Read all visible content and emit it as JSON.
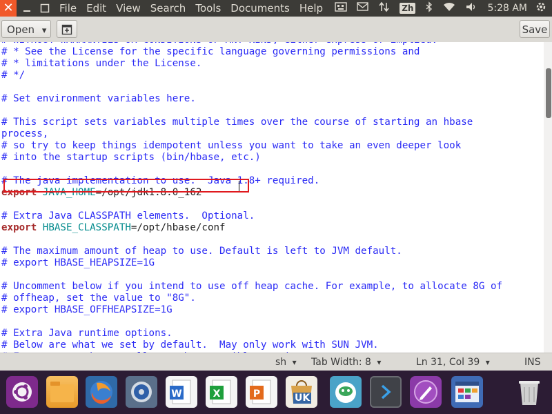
{
  "top_panel": {
    "close": "✕",
    "menu": [
      "File",
      "Edit",
      "View",
      "Search",
      "Tools",
      "Documents",
      "Help"
    ],
    "ime": "Zh",
    "clock": "5:28 AM"
  },
  "toolbar": {
    "open_label": "Open",
    "open_arrow": "▾",
    "new_tab_icon": "⊞",
    "save_label": "Save"
  },
  "editor": {
    "lines": [
      [
        {
          "t": "# WITHOUT WARRANTIES OR CONDITIONS OF ANY KIND, either express or implied.",
          "c": "comment"
        }
      ],
      [
        {
          "t": "# * See the License for the specific language governing permissions and",
          "c": "comment"
        }
      ],
      [
        {
          "t": "# * limitations under the License.",
          "c": "comment"
        }
      ],
      [
        {
          "t": "# */",
          "c": "comment"
        }
      ],
      [
        {
          "t": "",
          "c": "comment"
        }
      ],
      [
        {
          "t": "# Set environment variables here.",
          "c": "comment"
        }
      ],
      [
        {
          "t": "",
          "c": "comment"
        }
      ],
      [
        {
          "t": "# This script sets variables multiple times over the course of starting an hbase",
          "c": "comment"
        }
      ],
      [
        {
          "t": "process,",
          "c": "comment"
        }
      ],
      [
        {
          "t": "# so try to keep things idempotent unless you want to take an even deeper look",
          "c": "comment"
        }
      ],
      [
        {
          "t": "# into the startup scripts (bin/hbase, etc.)",
          "c": "comment"
        }
      ],
      [
        {
          "t": "",
          "c": "comment"
        }
      ],
      [
        {
          "t": "# The java implementation to use.  Java 1.8+ required.",
          "c": "comment"
        }
      ],
      [
        {
          "t": "export",
          "c": "kw"
        },
        {
          "t": " JAVA_HOME",
          "c": "var"
        },
        {
          "t": "=/opt/jdk1.8.0_162",
          "c": "plain"
        }
      ],
      [
        {
          "t": "",
          "c": "comment"
        }
      ],
      [
        {
          "t": "# Extra Java CLASSPATH elements.  Optional.",
          "c": "comment"
        }
      ],
      [
        {
          "t": "export",
          "c": "kw"
        },
        {
          "t": " HBASE_CLASSPATH",
          "c": "var"
        },
        {
          "t": "=/opt/hbase/conf",
          "c": "plain"
        }
      ],
      [
        {
          "t": "",
          "c": "comment"
        }
      ],
      [
        {
          "t": "# The maximum amount of heap to use. Default is left to JVM default.",
          "c": "comment"
        }
      ],
      [
        {
          "t": "# export HBASE_HEAPSIZE=1G",
          "c": "comment"
        }
      ],
      [
        {
          "t": "",
          "c": "comment"
        }
      ],
      [
        {
          "t": "# Uncomment below if you intend to use off heap cache. For example, to allocate 8G of",
          "c": "comment"
        }
      ],
      [
        {
          "t": "# offheap, set the value to \"8G\".",
          "c": "comment"
        }
      ],
      [
        {
          "t": "# export HBASE_OFFHEAPSIZE=1G",
          "c": "comment"
        }
      ],
      [
        {
          "t": "",
          "c": "comment"
        }
      ],
      [
        {
          "t": "# Extra Java runtime options.",
          "c": "comment"
        }
      ],
      [
        {
          "t": "# Below are what we set by default.  May only work with SUN JVM.",
          "c": "comment"
        }
      ],
      [
        {
          "t": "# For more on why as well as other possible settings,",
          "c": "comment"
        }
      ]
    ]
  },
  "status_bar": {
    "language": "sh",
    "tab_width": "Tab Width: 8",
    "position": "Ln 31, Col 39",
    "mode": "INS",
    "arrow": "▾"
  },
  "launcher": {
    "apps": [
      {
        "name": "ubuntu-dash-icon",
        "color": "#7e2a8c"
      },
      {
        "name": "files-icon",
        "color": "#f0a030"
      },
      {
        "name": "firefox-icon",
        "color": "#e8602c"
      },
      {
        "name": "disks-icon",
        "color": "#5a6f8a"
      },
      {
        "name": "writer-icon",
        "color": "#2a6ac8"
      },
      {
        "name": "calc-icon",
        "color": "#1e9f3c"
      },
      {
        "name": "impress-icon",
        "color": "#e36a1c"
      },
      {
        "name": "software-center-icon",
        "color": "#d9a24a"
      },
      {
        "name": "sticky-icon",
        "color": "#3aa65a"
      },
      {
        "name": "terminal-icon",
        "color": "#404248"
      },
      {
        "name": "text-editor-icon",
        "color": "#8b3aa8"
      },
      {
        "name": "system-settings-icon",
        "color": "#3f6bb5"
      },
      {
        "name": "trash-icon",
        "color": "#c7c7c7"
      }
    ],
    "uk_label": "UK"
  },
  "colors": {
    "comment": "#2b2bf5",
    "keyword": "#a52a2a",
    "variable": "#008a8c",
    "highlight_box": "#e0191e"
  }
}
